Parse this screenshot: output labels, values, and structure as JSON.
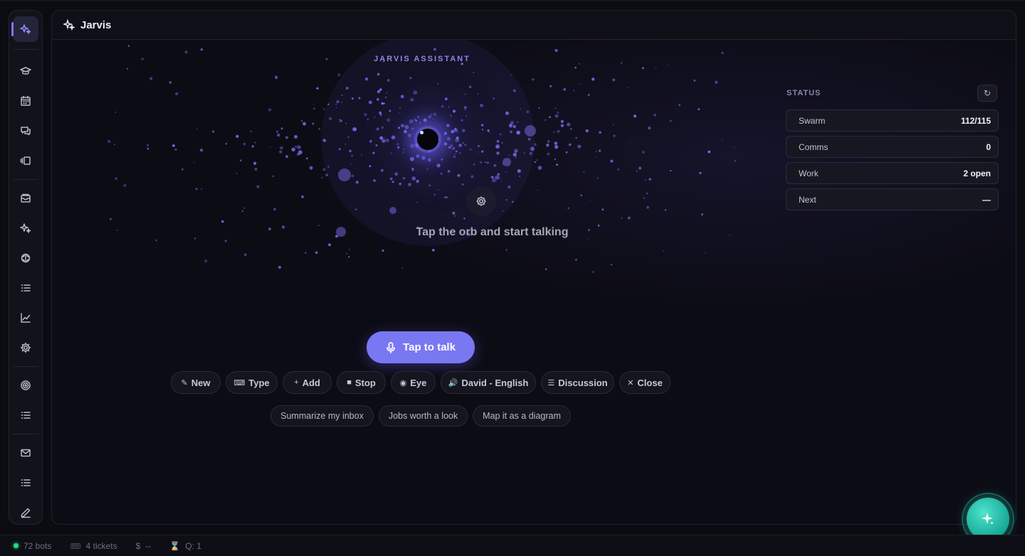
{
  "app": {
    "title": "Jarvis"
  },
  "sidebar": {
    "items": [
      {
        "icon": "sparkles-icon",
        "active": true
      },
      {
        "icon": "graduation-cap-icon"
      },
      {
        "icon": "calendar-icon"
      },
      {
        "icon": "chat-bubbles-icon"
      },
      {
        "icon": "cards-icon"
      },
      {
        "icon": "mailbox-icon"
      },
      {
        "icon": "sparkles-icon"
      },
      {
        "icon": "brain-icon"
      },
      {
        "icon": "list-icon"
      },
      {
        "icon": "line-chart-icon"
      },
      {
        "icon": "gear-icon"
      },
      {
        "icon": "target-icon"
      },
      {
        "icon": "list-icon"
      },
      {
        "icon": "mail-icon"
      },
      {
        "icon": "list-icon"
      },
      {
        "icon": "pencil-icon"
      }
    ]
  },
  "orb": {
    "label": "JARVIS ASSISTANT",
    "hint": "Tap the orb and start talking"
  },
  "status": {
    "title": "STATUS",
    "refresh_icon": "refresh-icon",
    "rows": [
      {
        "label": "Swarm",
        "value": "112/115"
      },
      {
        "label": "Comms",
        "value": "0"
      },
      {
        "label": "Work",
        "value": "2 open"
      },
      {
        "label": "Next",
        "value": "—"
      }
    ]
  },
  "talk": {
    "label": "Tap to talk",
    "icon": "microphone-icon"
  },
  "actions": [
    {
      "label": "New",
      "icon": "✎"
    },
    {
      "label": "Type",
      "icon": "⌨"
    },
    {
      "label": "Add",
      "icon": "+"
    },
    {
      "label": "Stop",
      "icon": "■"
    },
    {
      "label": "Eye",
      "icon": "◉"
    },
    {
      "label": "David - English",
      "icon": "🔊"
    },
    {
      "label": "Discussion",
      "icon": "☰"
    },
    {
      "label": "Close",
      "icon": "✕"
    }
  ],
  "suggestions": [
    "Summarize my inbox",
    "Jobs worth a look",
    "Map it as a diagram"
  ],
  "footer": {
    "bots": "72 bots",
    "tickets": "4 tickets",
    "cost_symbol": "$",
    "cost": "--",
    "queue": "Q: 1"
  },
  "colors": {
    "accent": "#7a77f2",
    "fab": "#17a896",
    "online": "#2bd884"
  }
}
